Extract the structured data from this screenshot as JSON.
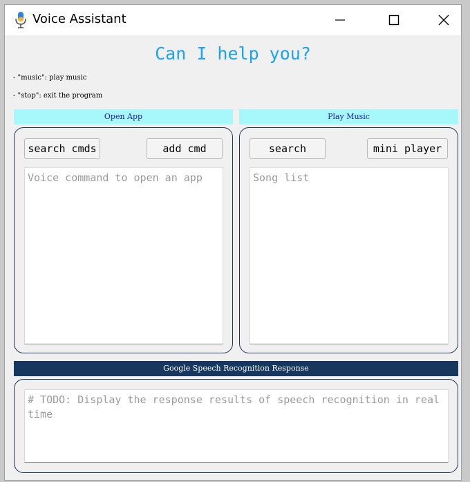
{
  "window": {
    "title": "Voice Assistant",
    "icon": "microphone-icon"
  },
  "controls": {
    "minimize": "minimize-icon",
    "maximize": "maximize-icon",
    "close": "close-icon"
  },
  "heading": "Can I help you?",
  "hints": [
    "- \"music\": play music",
    "- \"stop\": exit the program"
  ],
  "open_app": {
    "label": "Open App",
    "search_button": "search cmds",
    "add_button": "add cmd",
    "textarea_placeholder": "Voice command to open an app"
  },
  "play_music": {
    "label": "Play Music",
    "search_button": "search",
    "mini_player_button": "mini player",
    "textarea_placeholder": "Song list"
  },
  "google": {
    "label": "Google Speech Recognition Response",
    "textarea_placeholder": "# TODO: Display the response results of speech recognition in real time"
  },
  "colors": {
    "heading": "#1aa3ee",
    "section_label_bg": "#a7f8fb",
    "section_label_text": "#1b1bb8",
    "google_label_bg": "#17375e",
    "panel_border": "#1e3358"
  }
}
